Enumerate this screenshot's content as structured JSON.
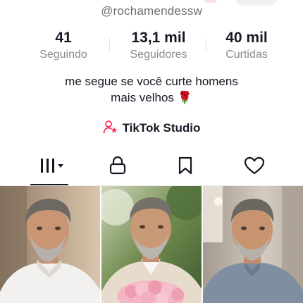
{
  "profile": {
    "username": "@rochamendessw",
    "bio_line1": "me segue se você curte homens",
    "bio_line2": "mais velhos 🌹"
  },
  "stats": [
    {
      "value": "41",
      "label": "Seguindo"
    },
    {
      "value": "13,1 mil",
      "label": "Seguidores"
    },
    {
      "value": "40 mil",
      "label": "Curtidas"
    }
  ],
  "studio": {
    "label": "TikTok Studio",
    "icon": "user-star-icon"
  },
  "tabs": [
    {
      "name": "videos-grid",
      "icon": "grid-bars-icon",
      "selected": true
    },
    {
      "name": "private",
      "icon": "lock-icon",
      "selected": false
    },
    {
      "name": "saved",
      "icon": "bookmark-icon",
      "selected": false
    },
    {
      "name": "liked",
      "icon": "heart-icon",
      "selected": false
    }
  ],
  "colors": {
    "accent": "#fe2c55",
    "text": "#161823",
    "secondary": "#8a8b91"
  }
}
